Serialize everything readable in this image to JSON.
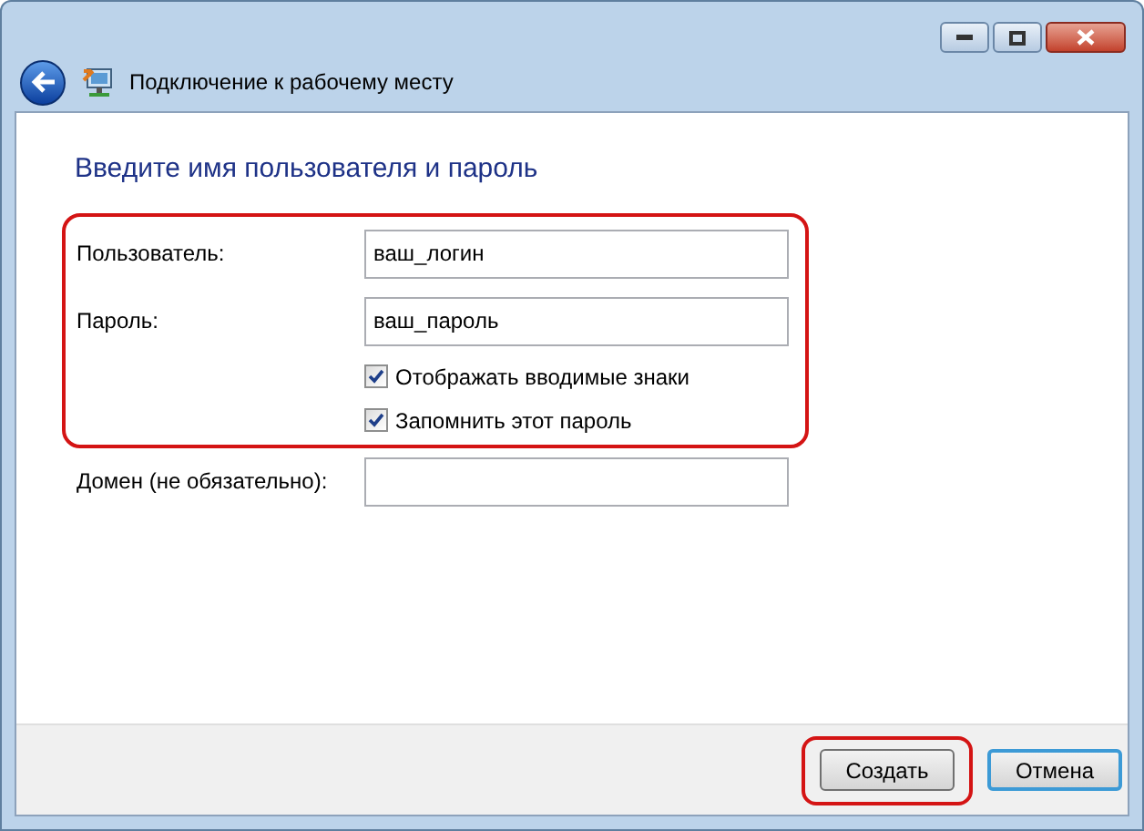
{
  "window": {
    "title": "Подключение к рабочему месту"
  },
  "heading": "Введите имя пользователя и пароль",
  "highlighted_group": [
    {
      "kind": "field",
      "label": "Пользователь:",
      "value": "ваш_логин"
    },
    {
      "kind": "field",
      "label": "Пароль:",
      "value": "ваш_пароль"
    },
    {
      "kind": "checkbox",
      "label": "Отображать вводимые знаки",
      "checked": true
    },
    {
      "kind": "checkbox",
      "label": "Запомнить этот пароль",
      "checked": true
    }
  ],
  "other_fields": [
    {
      "kind": "field",
      "label": "Домен (не обязательно):"
    }
  ],
  "buttons": [
    {
      "label": "Создать",
      "highlighted": true,
      "default": false
    },
    {
      "label": "Отмена",
      "highlighted": false,
      "default": true
    }
  ]
}
